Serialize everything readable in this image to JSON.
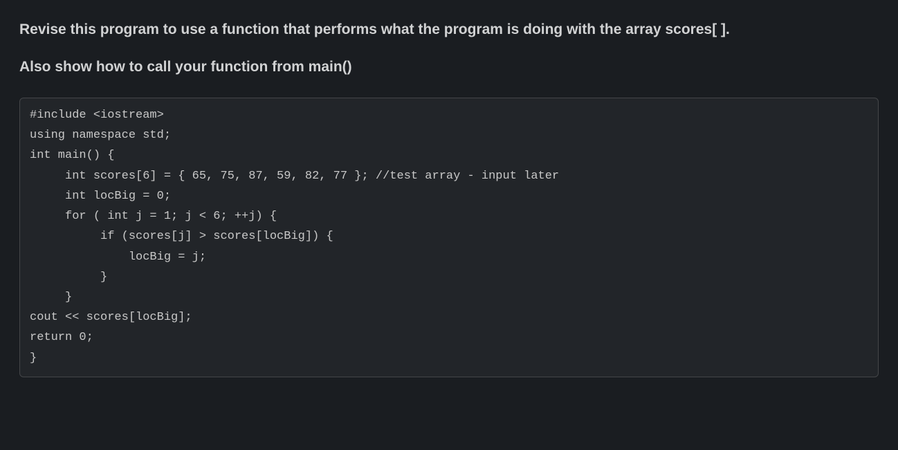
{
  "instruction": {
    "para1": "Revise this program to use a function that performs what the program is doing with the array scores[ ].",
    "para2": "Also show how to call your function  from main()"
  },
  "code": "#include <iostream>\nusing namespace std;\nint main() {\n     int scores[6] = { 65, 75, 87, 59, 82, 77 }; //test array - input later\n     int locBig = 0;\n     for ( int j = 1; j < 6; ++j) {\n          if (scores[j] > scores[locBig]) {\n              locBig = j;\n          }\n     }\ncout << scores[locBig];\nreturn 0;\n}"
}
